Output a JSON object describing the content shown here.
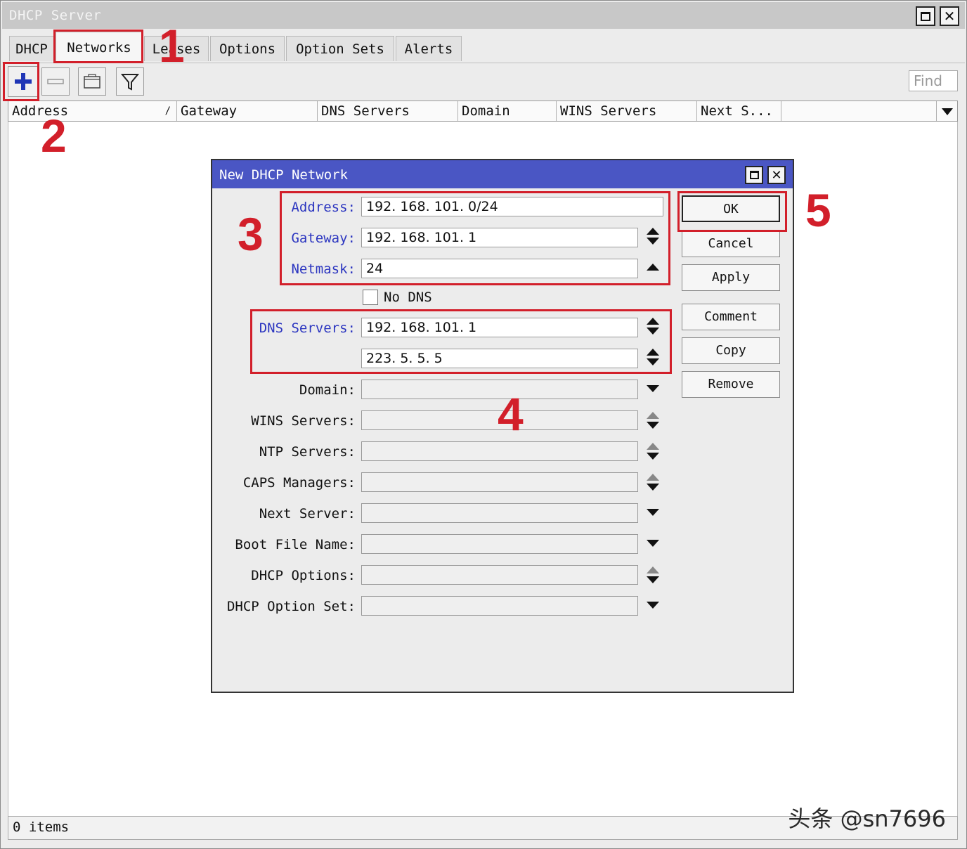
{
  "window": {
    "title": "DHCP Server"
  },
  "tabs": [
    {
      "label": "DHCP"
    },
    {
      "label": "Networks"
    },
    {
      "label": "Leases"
    },
    {
      "label": "Options"
    },
    {
      "label": "Option Sets"
    },
    {
      "label": "Alerts"
    }
  ],
  "toolbar": {
    "add_icon": "plus-icon",
    "remove_icon": "minus-icon",
    "comment_icon": "note-icon",
    "filter_icon": "filter-icon",
    "find_placeholder": "Find"
  },
  "table": {
    "columns": [
      "Address",
      "Gateway",
      "DNS Servers",
      "Domain",
      "WINS Servers",
      "Next S..."
    ],
    "sort_mark": "/"
  },
  "status": {
    "items": "0 items"
  },
  "dialog": {
    "title": "New DHCP Network",
    "fields": {
      "address": {
        "label": "Address:",
        "value": "192. 168. 101. 0/24"
      },
      "gateway": {
        "label": "Gateway:",
        "value": "192. 168. 101. 1"
      },
      "netmask": {
        "label": "Netmask:",
        "value": "24"
      },
      "no_dns": {
        "label": "No DNS",
        "checked": false
      },
      "dns_servers": {
        "label": "DNS Servers:",
        "values": [
          "192. 168. 101. 1",
          "223. 5. 5. 5"
        ]
      },
      "domain": {
        "label": "Domain:",
        "value": ""
      },
      "wins_servers": {
        "label": "WINS Servers:",
        "value": ""
      },
      "ntp_servers": {
        "label": "NTP Servers:",
        "value": ""
      },
      "caps_managers": {
        "label": "CAPS Managers:",
        "value": ""
      },
      "next_server": {
        "label": "Next Server:",
        "value": ""
      },
      "boot_file_name": {
        "label": "Boot File Name:",
        "value": ""
      },
      "dhcp_options": {
        "label": "DHCP Options:",
        "value": ""
      },
      "dhcp_option_set": {
        "label": "DHCP Option Set:",
        "value": ""
      }
    },
    "buttons": {
      "ok": "OK",
      "cancel": "Cancel",
      "apply": "Apply",
      "comment": "Comment",
      "copy": "Copy",
      "remove": "Remove"
    }
  },
  "annotations": {
    "n1": "1",
    "n2": "2",
    "n3": "3",
    "n4": "4",
    "n5": "5"
  },
  "watermark": "头条 @sn7696",
  "colors": {
    "annotation_red": "#d21f2a",
    "dialog_title_blue": "#4a56c4",
    "label_blue": "#2c36c0"
  }
}
